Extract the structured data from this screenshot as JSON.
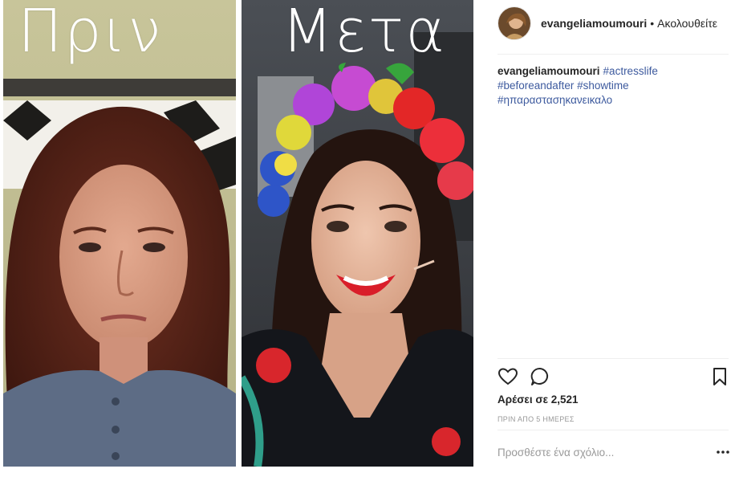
{
  "images": {
    "before_caption": "Πριν",
    "after_caption": "Μετα"
  },
  "header": {
    "username": "evangeliamoumouri",
    "separator": "•",
    "follow_label": "Ακολουθείτε"
  },
  "description": {
    "username": "evangeliamoumouri",
    "hashtags": [
      "#actresslife",
      "#beforeandafter",
      "#showtime",
      "#ηπαραστασηκανεικαλο"
    ]
  },
  "actions": {
    "like_icon": "heart-icon",
    "comment_icon": "comment-bubble-icon",
    "save_icon": "bookmark-icon"
  },
  "likes_text": "Αρέσει σε 2,521",
  "timestamp": "ΠΡΙΝ ΑΠΟ 5 ΗΜΕΡΕΣ",
  "comment": {
    "placeholder": "Προσθέστε ένα σχόλιο...",
    "value": "",
    "more_icon": "more-options-icon"
  },
  "colors": {
    "text": "#262626",
    "hashtag": "#3d5a9e",
    "muted": "#999999",
    "divider": "#efefef"
  }
}
